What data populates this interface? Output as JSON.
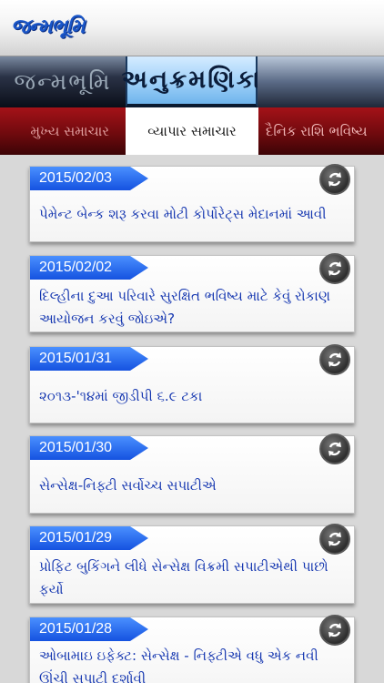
{
  "header": {
    "logo": "જન્મભૂમિ"
  },
  "tabs_top": {
    "left": "જન્મભૂમિ",
    "active": "અનુક્રમણિકા"
  },
  "tabs_bottom": {
    "left": "મુખ્ય સમાચાર",
    "active": "વ્યાપાર સમાચાર",
    "right": "દૈનિક રાશિ ભવિષ્ય"
  },
  "articles": [
    {
      "date": "2015/02/03",
      "title": "પેમેન્ટ બેન્ક શરૂ કરવા મોટી કોર્પોરેટ્સ મેદાનમાં આવી"
    },
    {
      "date": "2015/02/02",
      "title": "દિલ્હીના દુઆ પરિવારે સુરક્ષિત ભવિષ્ય માટે કેવું રોકાણ આયોજન કરવું જોઇએ?"
    },
    {
      "date": "2015/01/31",
      "title": "૨૦૧૩-'૧૪માં જીડીપી ૬.૯ ટકા"
    },
    {
      "date": "2015/01/30",
      "title": "સેન્સેક્ષ-નિફ્ટી સર્વોચ્ચ સપાટીએ"
    },
    {
      "date": "2015/01/29",
      "title": "પ્રોફિટ બુકિંગને લીધે સેન્સેક્ષ વિક્રમી સપાટીએથી પાછો ફર્યો"
    },
    {
      "date": "2015/01/28",
      "title": "ઓબામાઇ ઇફેક્ટ: સેન્સેક્ષ - નિફ્ટીએ વધુ એક નવી ઊંચી સપાટી દર્શાવી"
    }
  ],
  "icons": {
    "refresh": "refresh-icon"
  },
  "colors": {
    "accent": "#1552e0",
    "headline": "#1436b0",
    "news_red": "#a41218"
  }
}
